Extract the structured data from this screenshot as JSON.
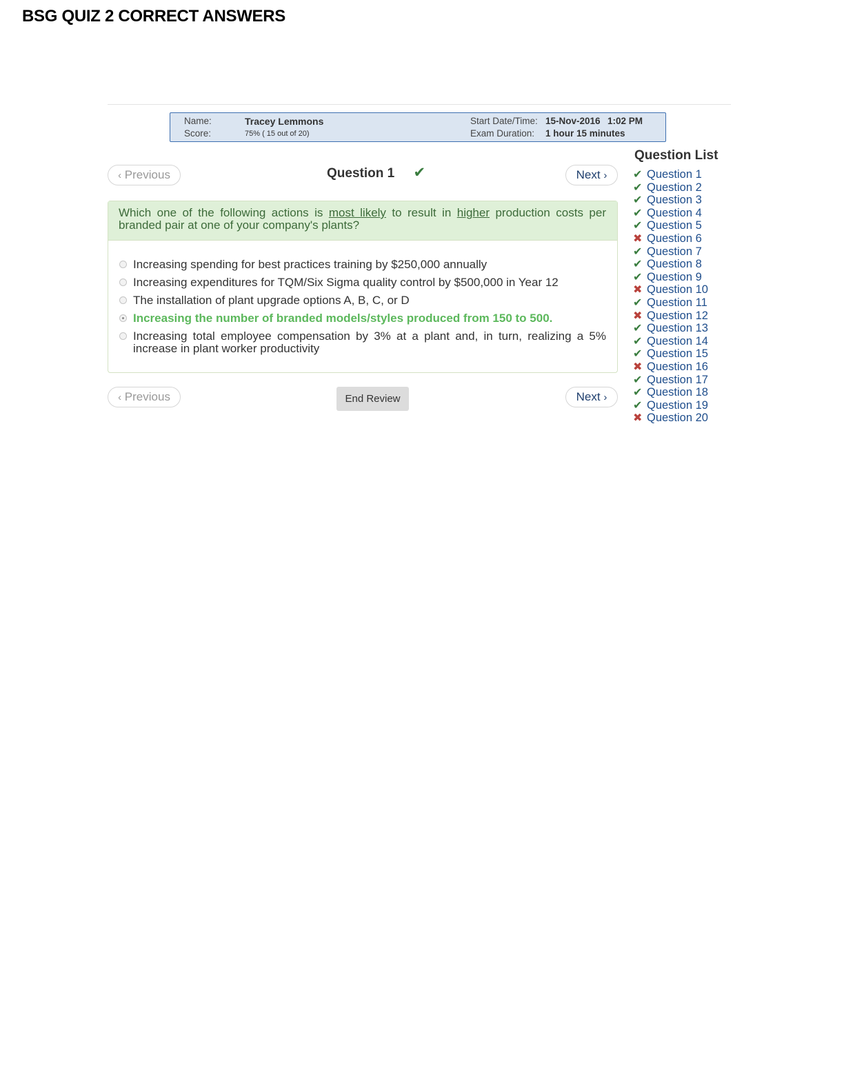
{
  "document": {
    "title": "BSG QUIZ 2 CORRECT ANSWERS"
  },
  "info": {
    "name_label": "Name:",
    "name_value": "Tracey Lemmons",
    "score_label": "Score:",
    "score_value": "75% ( 15 out of 20)",
    "start_label": "Start Date/Time:",
    "start_date": "15-Nov-2016",
    "start_time": "1:02 PM",
    "duration_label": "Exam Duration:",
    "duration_value": "1 hour 15 minutes"
  },
  "nav": {
    "prev_label": "Previous",
    "next_label": "Next",
    "prev_icon": "chevron-left-icon",
    "next_icon": "chevron-right-icon",
    "end_review_label": "End Review"
  },
  "question": {
    "heading": "Question 1",
    "status_icon": "checkmark-icon",
    "status": "correct",
    "text_parts": [
      "Which one of the following actions is ",
      "most likely",
      " to result in ",
      "higher",
      " production costs per branded pair at one of your company's plants?"
    ],
    "options": [
      {
        "text": "Increasing spending for best practices training by $250,000 annually",
        "selected": false,
        "correct": false
      },
      {
        "text": "Increasing expenditures for TQM/Six Sigma quality control by $500,000 in Year 12",
        "selected": false,
        "correct": false
      },
      {
        "text": "The installation of plant upgrade options A, B, C, or D",
        "selected": false,
        "correct": false
      },
      {
        "text": "Increasing the number of branded models/styles produced from 150 to 500.",
        "selected": true,
        "correct": true
      },
      {
        "text": "Increasing total employee compensation by 3% at a plant and, in turn, realizing a 5% increase in plant worker productivity",
        "selected": false,
        "correct": false
      }
    ]
  },
  "question_list": {
    "title": "Question List",
    "items": [
      {
        "label": "Question 1",
        "status": "correct"
      },
      {
        "label": "Question 2",
        "status": "correct"
      },
      {
        "label": "Question 3",
        "status": "correct"
      },
      {
        "label": "Question 4",
        "status": "correct"
      },
      {
        "label": "Question 5",
        "status": "correct"
      },
      {
        "label": "Question 6",
        "status": "incorrect"
      },
      {
        "label": "Question 7",
        "status": "correct"
      },
      {
        "label": "Question 8",
        "status": "correct"
      },
      {
        "label": "Question 9",
        "status": "correct"
      },
      {
        "label": "Question 10",
        "status": "incorrect"
      },
      {
        "label": "Question 11",
        "status": "correct"
      },
      {
        "label": "Question 12",
        "status": "incorrect"
      },
      {
        "label": "Question 13",
        "status": "correct"
      },
      {
        "label": "Question 14",
        "status": "correct"
      },
      {
        "label": "Question 15",
        "status": "correct"
      },
      {
        "label": "Question 16",
        "status": "incorrect"
      },
      {
        "label": "Question 17",
        "status": "correct"
      },
      {
        "label": "Question 18",
        "status": "correct"
      },
      {
        "label": "Question 19",
        "status": "correct"
      },
      {
        "label": "Question 20",
        "status": "incorrect"
      }
    ]
  },
  "colors": {
    "correct": "#3a7d3f",
    "incorrect": "#b9423c",
    "link": "#1f4e8c",
    "info_bg": "#dbe5f1",
    "question_bg": "#dff0d8"
  }
}
